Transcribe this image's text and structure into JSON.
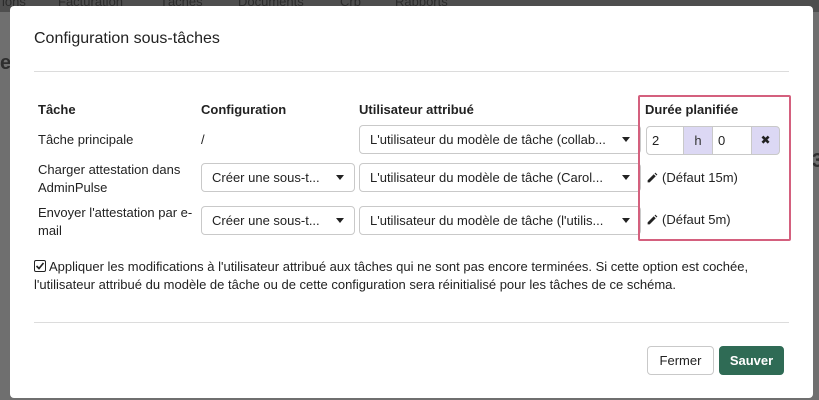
{
  "background": {
    "nav_items": [
      "ions",
      "Facturation",
      "Tâches",
      "Documents",
      "Crb",
      "Rapports"
    ],
    "stubs": [
      "e",
      "3"
    ]
  },
  "modal": {
    "title": "Configuration sous-tâches",
    "columns": {
      "task": "Tâche",
      "configuration": "Configuration",
      "assigned_user": "Utilisateur attribué",
      "planned_duration": "Durée planifiée"
    },
    "rows": [
      {
        "task": "Tâche principale",
        "configuration": "/",
        "assigned_user": "L'utilisateur du modèle de tâche (collab...",
        "duration": {
          "hours": "2",
          "hours_unit": "h",
          "minutes": "0",
          "clear_symbol": "✖"
        }
      },
      {
        "task": "Charger attestation dans AdminPulse",
        "configuration": "Créer une sous-t...",
        "assigned_user": "L'utilisateur du modèle de tâche (Carol...",
        "duration_default": "(Défaut 15m)"
      },
      {
        "task": "Envoyer l'attestation par e-mail",
        "configuration": "Créer une sous-t...",
        "assigned_user": "L'utilisateur du modèle de tâche (l'utilis...",
        "duration_default": "(Défaut 5m)"
      }
    ],
    "apply_checkbox": {
      "checked": true,
      "label": "Appliquer les modifications à l'utilisateur attribué aux tâches qui ne sont pas encore terminées. Si cette option est cochée, l'utilisateur attribué du modèle de tâche ou de cette configuration sera réinitialisé pour les tâches de ce schéma."
    },
    "buttons": {
      "close": "Fermer",
      "save": "Sauver"
    },
    "colors": {
      "save_bg": "#2f6b55",
      "highlight_border": "#d4607e",
      "duration_addon_bg": "#dcd8f4"
    }
  }
}
